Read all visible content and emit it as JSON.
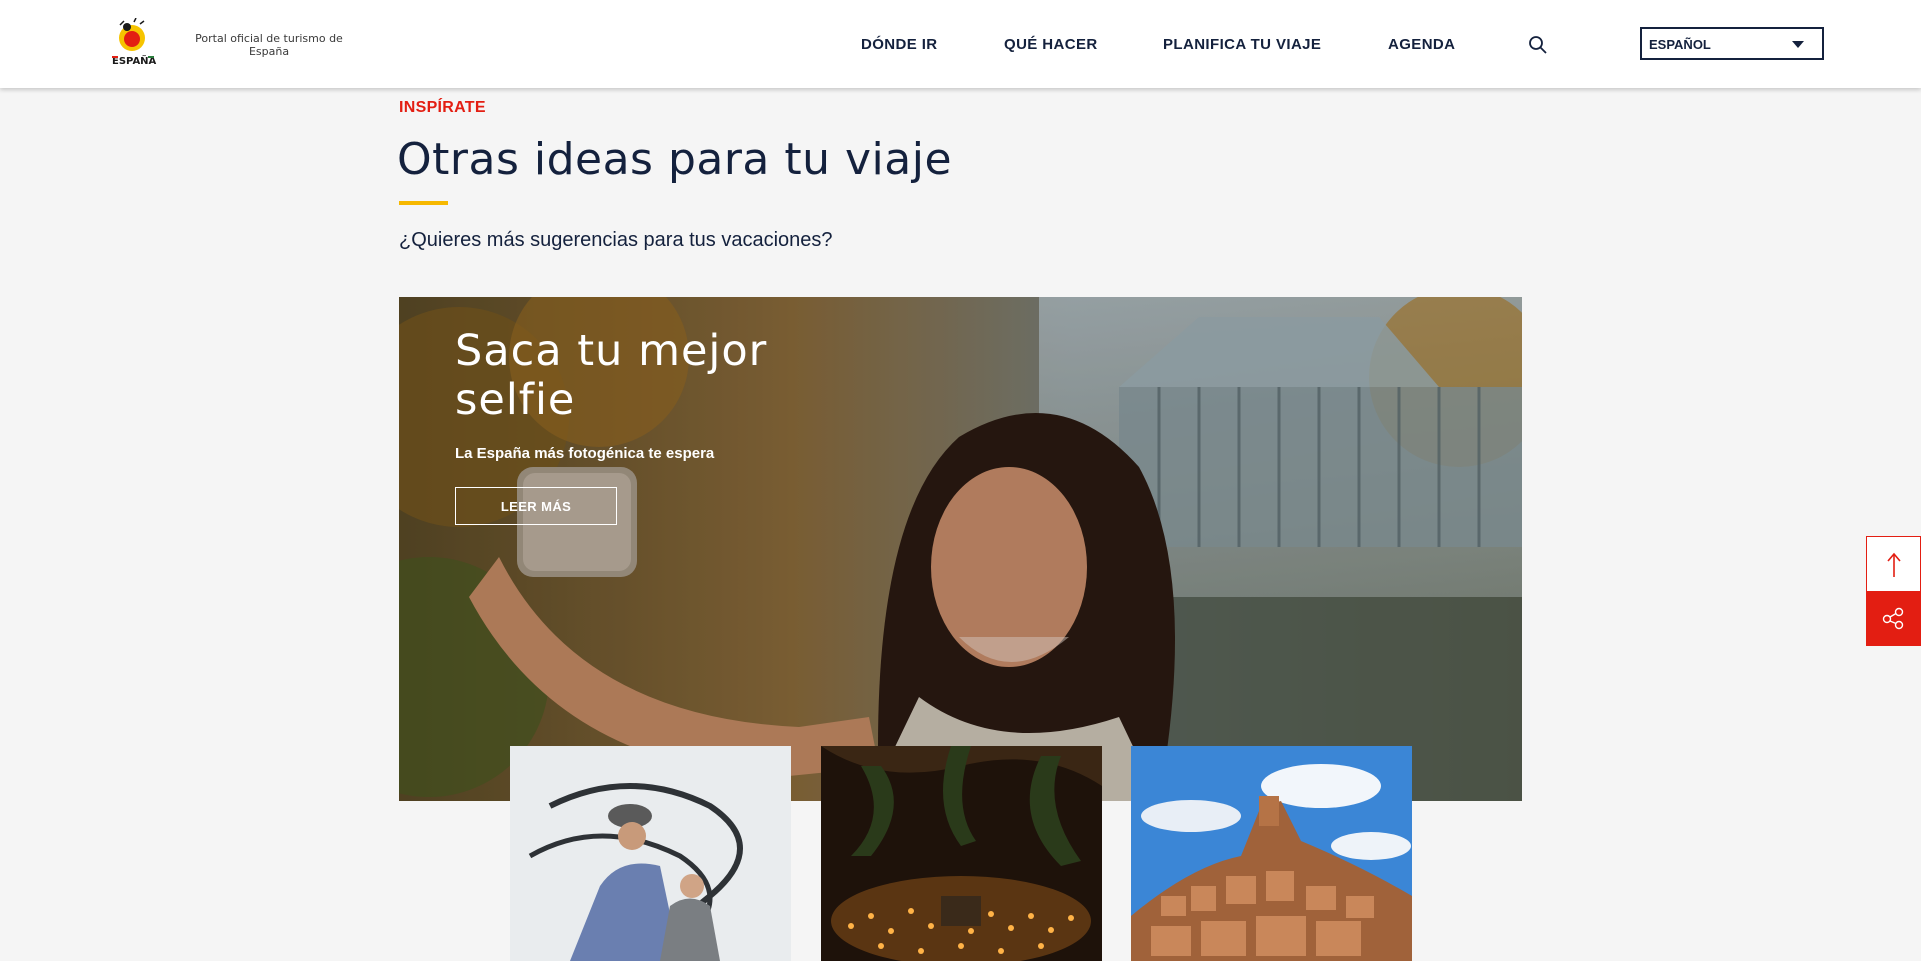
{
  "header": {
    "logo_icon": "espana-logo",
    "tagline": "Portal oficial de turismo de España",
    "nav": [
      "DÓNDE IR",
      "QUÉ HACER",
      "PLANIFICA TU VIAJE",
      "AGENDA"
    ],
    "search_icon": "search-icon",
    "language": "ESPAÑOL"
  },
  "section": {
    "eyebrow": "INSPÍRATE",
    "title": "Otras ideas para tu viaje",
    "subtitle": "¿Quieres más sugerencias para tus vacaciones?"
  },
  "hero": {
    "title": "Saca tu mejor selfie",
    "subtitle": "La España más fotogénica te espera",
    "button": "LEER MÁS"
  },
  "cards": [
    "museum-stairs-image",
    "candlelit-palm-garden-image",
    "hilltop-castle-village-image"
  ],
  "side_buttons": [
    "arrow-up-icon",
    "share-icon"
  ],
  "colors": {
    "accent_red": "#e31e12",
    "accent_yellow": "#f6b800",
    "navy": "#14213d"
  }
}
